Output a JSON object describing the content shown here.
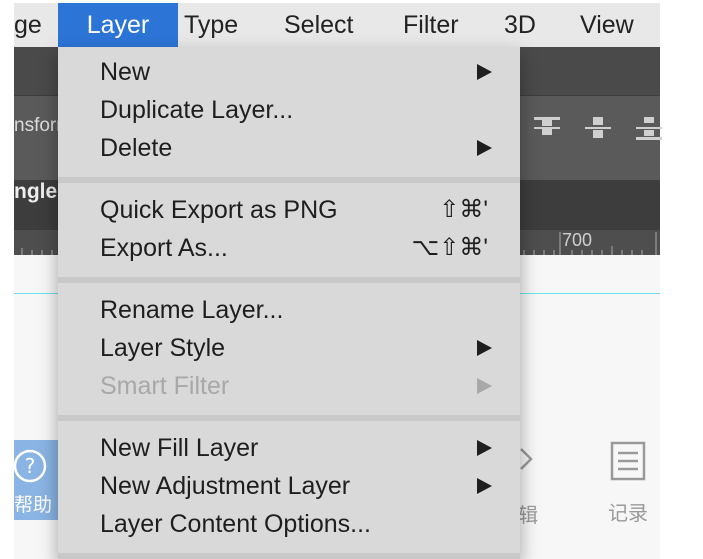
{
  "menubar": {
    "items": [
      {
        "label": "ge"
      },
      {
        "label": "Layer"
      },
      {
        "label": "Type"
      },
      {
        "label": "Select"
      },
      {
        "label": "Filter"
      },
      {
        "label": "3D"
      },
      {
        "label": "View"
      }
    ],
    "active": "Layer"
  },
  "photoshop": {
    "transform_text": "nsforr",
    "tab_text": "ngle",
    "ruler_mark": "700"
  },
  "layer_menu": {
    "items": [
      {
        "label": "New",
        "submenu": true
      },
      {
        "label": "Duplicate Layer..."
      },
      {
        "label": "Delete",
        "submenu": true
      },
      {
        "label": "Quick Export as PNG",
        "shortcut": "⇧⌘'"
      },
      {
        "label": "Export As...",
        "shortcut": "⌥⇧⌘'"
      },
      {
        "label": "Rename Layer..."
      },
      {
        "label": "Layer Style",
        "submenu": true
      },
      {
        "label": "Smart Filter",
        "submenu": true,
        "disabled": true
      },
      {
        "label": "New Fill Layer",
        "submenu": true
      },
      {
        "label": "New Adjustment Layer",
        "submenu": true
      },
      {
        "label": "Layer Content Options..."
      }
    ]
  },
  "app": {
    "help_label": "帮助",
    "edit_label": "辑",
    "records_label": "记录"
  },
  "colors": {
    "menu_highlight": "#2c74d6",
    "menu_background": "#d9d9d9",
    "disabled_text": "#a8a8a8",
    "ps_dark": "#535353",
    "help_blue": "#8ab4e3"
  },
  "icons": [
    "submenu-arrow-icon",
    "align-center-icon",
    "help-circle-icon",
    "chevron-right-icon",
    "document-list-icon"
  ]
}
